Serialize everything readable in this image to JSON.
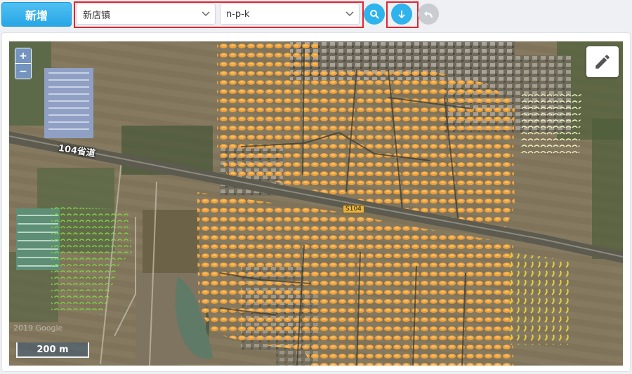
{
  "toolbar": {
    "add_label": "新增",
    "town_select": {
      "value": "新店镇"
    },
    "layer_select": {
      "value": "n-p-k"
    }
  },
  "map": {
    "road_label": "104省道",
    "route_shield": "S104",
    "scale_label": "200 m",
    "watermark": "2019 Google",
    "zoom_in": "+",
    "zoom_out": "−"
  },
  "icons": {
    "search": "search-icon",
    "download": "arrow-down-icon",
    "undo": "undo-icon",
    "edit": "pencil-icon",
    "chevron": "chevron-down-icon"
  },
  "colors": {
    "primary": "#2fb3ec",
    "highlight": "#e5242e",
    "marker_orange": "#f2a23a",
    "marker_green": "#6fcf3a",
    "marker_yellow": "#e8d24a",
    "marker_pale": "#e9edb9"
  }
}
